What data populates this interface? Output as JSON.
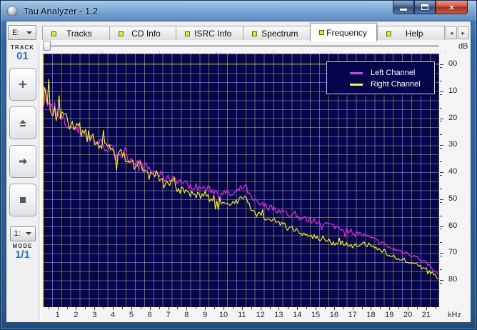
{
  "window": {
    "title": "Tau Analyzer - 1.2"
  },
  "tabs": {
    "items": [
      {
        "label": "Tracks",
        "active": false
      },
      {
        "label": "CD Info",
        "active": false
      },
      {
        "label": "ISRC Info",
        "active": false
      },
      {
        "label": "Spectrum",
        "active": false
      },
      {
        "label": "Frequency",
        "active": true
      },
      {
        "label": "Help",
        "active": false
      }
    ],
    "scroll_left": "◄",
    "scroll_right": "►",
    "indicator_color": "#e6ec00"
  },
  "sidebar": {
    "drive_combo": {
      "value": "E:"
    },
    "track": {
      "label": "TRACK",
      "value": "01"
    },
    "transport_buttons": [
      {
        "name": "plus"
      },
      {
        "name": "eject"
      },
      {
        "name": "next"
      },
      {
        "name": "stop"
      }
    ],
    "mode_combo": {
      "value": "1:"
    },
    "mode": {
      "label": "MODE",
      "value": "1/1"
    }
  },
  "chart_data": {
    "type": "line",
    "xlabel": "kHz",
    "ylabel": "dB",
    "x_range": [
      0.2,
      21.7
    ],
    "y_range_db": [
      4,
      -90
    ],
    "x_ticks": [
      1,
      2,
      3,
      4,
      5,
      6,
      7,
      8,
      9,
      10,
      11,
      12,
      13,
      14,
      15,
      16,
      17,
      18,
      19,
      20,
      21
    ],
    "x_minor_step": 0.5,
    "y_ticks": [
      {
        "db": 0,
        "label": "00"
      },
      {
        "db": -10,
        "label": "10"
      },
      {
        "db": -20,
        "label": "20"
      },
      {
        "db": -30,
        "label": "30"
      },
      {
        "db": -40,
        "label": "40"
      },
      {
        "db": -50,
        "label": "50"
      },
      {
        "db": -60,
        "label": "60"
      },
      {
        "db": -70,
        "label": "70"
      },
      {
        "db": -80,
        "label": "80"
      }
    ],
    "y_minor_step": 5,
    "background": "#06064e",
    "grid_color": "#8a8660",
    "legend_position": "top-right",
    "sample_step": 0.08,
    "noise_amplitude": [
      [
        0.2,
        4.5
      ],
      [
        1,
        3.5
      ],
      [
        3,
        2.2
      ],
      [
        8,
        1.5
      ],
      [
        14,
        1.2
      ],
      [
        21.7,
        0.7
      ]
    ],
    "series": [
      {
        "name": "Left Channel",
        "color": "#ff22ff",
        "seed": 7,
        "anchors": [
          [
            0.2,
            -13
          ],
          [
            0.35,
            -10.8
          ],
          [
            0.5,
            -16
          ],
          [
            0.8,
            -18
          ],
          [
            1,
            -19.5
          ],
          [
            1.5,
            -22
          ],
          [
            2,
            -24
          ],
          [
            2.5,
            -26
          ],
          [
            3,
            -28
          ],
          [
            3.5,
            -30
          ],
          [
            4,
            -32
          ],
          [
            4.5,
            -33.5
          ],
          [
            5,
            -35
          ],
          [
            5.5,
            -37
          ],
          [
            6,
            -39
          ],
          [
            6.5,
            -41
          ],
          [
            7,
            -42.5
          ],
          [
            7.3,
            -41.5
          ],
          [
            7.5,
            -43
          ],
          [
            8,
            -44.5
          ],
          [
            8.5,
            -45.5
          ],
          [
            9,
            -46
          ],
          [
            9.5,
            -47
          ],
          [
            10,
            -47.5
          ],
          [
            10.5,
            -48.5
          ],
          [
            11,
            -45.8
          ],
          [
            11.2,
            -45.2
          ],
          [
            11.5,
            -50
          ],
          [
            12,
            -52
          ],
          [
            12.5,
            -53
          ],
          [
            13,
            -54
          ],
          [
            13.5,
            -55.5
          ],
          [
            14,
            -56.5
          ],
          [
            14.5,
            -57.5
          ],
          [
            15,
            -58
          ],
          [
            15.5,
            -59
          ],
          [
            16,
            -60
          ],
          [
            16.5,
            -61
          ],
          [
            17,
            -62
          ],
          [
            17.5,
            -63
          ],
          [
            18,
            -64.5
          ],
          [
            18.5,
            -66
          ],
          [
            19,
            -68
          ],
          [
            19.5,
            -69
          ],
          [
            20,
            -70
          ],
          [
            20.5,
            -71.5
          ],
          [
            21,
            -73.5
          ],
          [
            21.4,
            -76
          ],
          [
            21.7,
            -78.5
          ]
        ]
      },
      {
        "name": "Right Channel",
        "color": "#ffff00",
        "seed": 91,
        "anchors": [
          [
            0.2,
            -11.5
          ],
          [
            0.35,
            -10
          ],
          [
            0.5,
            -14.5
          ],
          [
            0.8,
            -17
          ],
          [
            1,
            -18.5
          ],
          [
            1.5,
            -21.5
          ],
          [
            2,
            -23.5
          ],
          [
            2.5,
            -26
          ],
          [
            3,
            -28.2
          ],
          [
            3.5,
            -30.5
          ],
          [
            4,
            -32.5
          ],
          [
            4.5,
            -34.5
          ],
          [
            5,
            -36
          ],
          [
            5.5,
            -38
          ],
          [
            6,
            -40
          ],
          [
            6.5,
            -42.5
          ],
          [
            7,
            -44.5
          ],
          [
            7.3,
            -43.8
          ],
          [
            7.5,
            -46
          ],
          [
            8,
            -47.5
          ],
          [
            8.5,
            -48.5
          ],
          [
            9,
            -49
          ],
          [
            9.5,
            -50
          ],
          [
            10,
            -51
          ],
          [
            10.5,
            -51.8
          ],
          [
            11,
            -48.8
          ],
          [
            11.2,
            -48.3
          ],
          [
            11.5,
            -54
          ],
          [
            12,
            -56
          ],
          [
            12.5,
            -57
          ],
          [
            13,
            -58.5
          ],
          [
            13.5,
            -60.5
          ],
          [
            14,
            -62
          ],
          [
            14.5,
            -63
          ],
          [
            15,
            -64
          ],
          [
            15.5,
            -65
          ],
          [
            16,
            -66
          ],
          [
            16.5,
            -66.5
          ],
          [
            17,
            -67.5
          ],
          [
            17.6,
            -66.8
          ],
          [
            18,
            -67.2
          ],
          [
            18.5,
            -68.5
          ],
          [
            19,
            -70.5
          ],
          [
            19.5,
            -72
          ],
          [
            20,
            -73
          ],
          [
            20.5,
            -74.5
          ],
          [
            21,
            -76
          ],
          [
            21.4,
            -77.8
          ],
          [
            21.7,
            -79.8
          ]
        ]
      }
    ]
  }
}
